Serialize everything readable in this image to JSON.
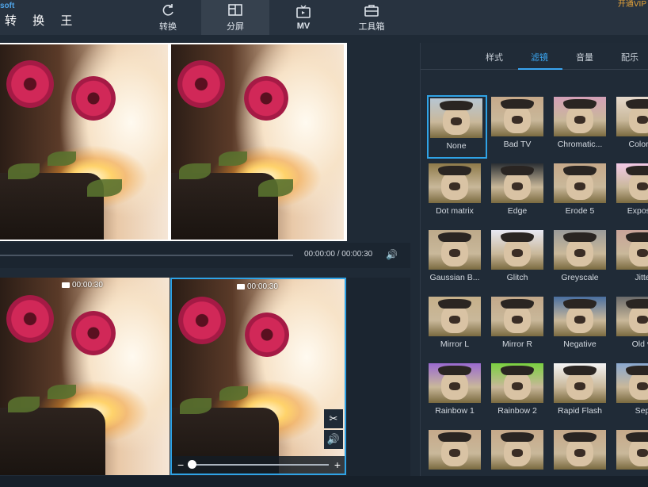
{
  "app": {
    "brand_small": "soft",
    "title": "转 换 王",
    "vip": "开通VIP"
  },
  "nav": [
    {
      "label": "转换",
      "icon": "refresh-icon"
    },
    {
      "label": "分屏",
      "icon": "split-screen-icon",
      "active": true
    },
    {
      "label": "MV",
      "icon": "tv-icon"
    },
    {
      "label": "工具箱",
      "icon": "toolbox-icon"
    }
  ],
  "player": {
    "time": "00:00:00 / 00:00:30"
  },
  "clips": [
    {
      "duration": "00:00:30"
    },
    {
      "duration": "00:00:30"
    }
  ],
  "panel": {
    "tabs": [
      "样式",
      "滤镜",
      "音量",
      "配乐"
    ],
    "active_tab": "滤镜",
    "filters": [
      "None",
      "Bad TV",
      "Chromatic...",
      "Color S",
      "Dot matrix",
      "Edge",
      "Erode 5",
      "Exposur",
      "Gaussian B...",
      "Glitch",
      "Greyscale",
      "Jitte",
      "Mirror L",
      "Mirror R",
      "Negative",
      "Old vi",
      "Rainbow 1",
      "Rainbow 2",
      "Rapid Flash",
      "Sep",
      "",
      "",
      "",
      ""
    ],
    "selected_filter": "None"
  },
  "colors": {
    "accent": "#2fa3e6",
    "background": "#1f2a36",
    "topbar": "#283340"
  }
}
